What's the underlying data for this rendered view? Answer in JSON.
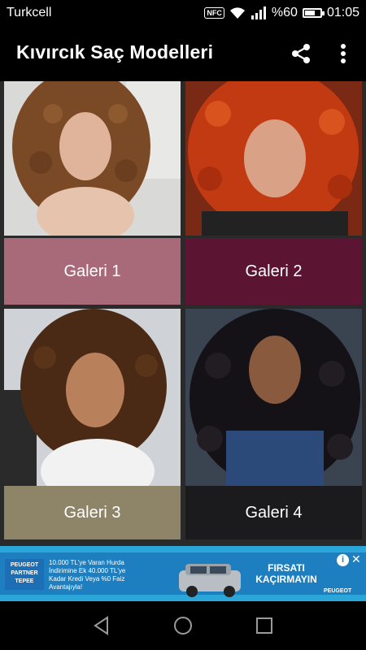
{
  "status": {
    "carrier": "Turkcell",
    "nfc": "NFC",
    "battery": "%60",
    "time": "01:05"
  },
  "app": {
    "title": "Kıvırcık Saç Modelleri"
  },
  "galleries": [
    {
      "label": "Galeri 1",
      "label_bg": "#a86a78",
      "hair": "#7a4a26"
    },
    {
      "label": "Galeri 2",
      "label_bg": "#5b1432",
      "hair": "#c23a12"
    },
    {
      "label": "Galeri 3",
      "label_bg": "#8e8468",
      "hair": "#4a2a14"
    },
    {
      "label": "Galeri 4",
      "label_bg": "#1b1b1e",
      "hair": "#141216"
    }
  ],
  "ad": {
    "brand_logo_lines": [
      "PEUGEOT",
      "PARTNER",
      "TEPEE"
    ],
    "text_lines": [
      "10.000 TL'ye Varan Hurda",
      "İndirimine Ek 40.000 TL'ye",
      "Kadar Kredi Veya %0 Faiz",
      "Avantajıyla!"
    ],
    "cta_lines": [
      "FIRSATI",
      "KAÇIRMAYIN"
    ],
    "brand": "PEUGEOT"
  },
  "colors": {
    "accent": "#000000",
    "ad_bg": "#1d7fc0"
  }
}
